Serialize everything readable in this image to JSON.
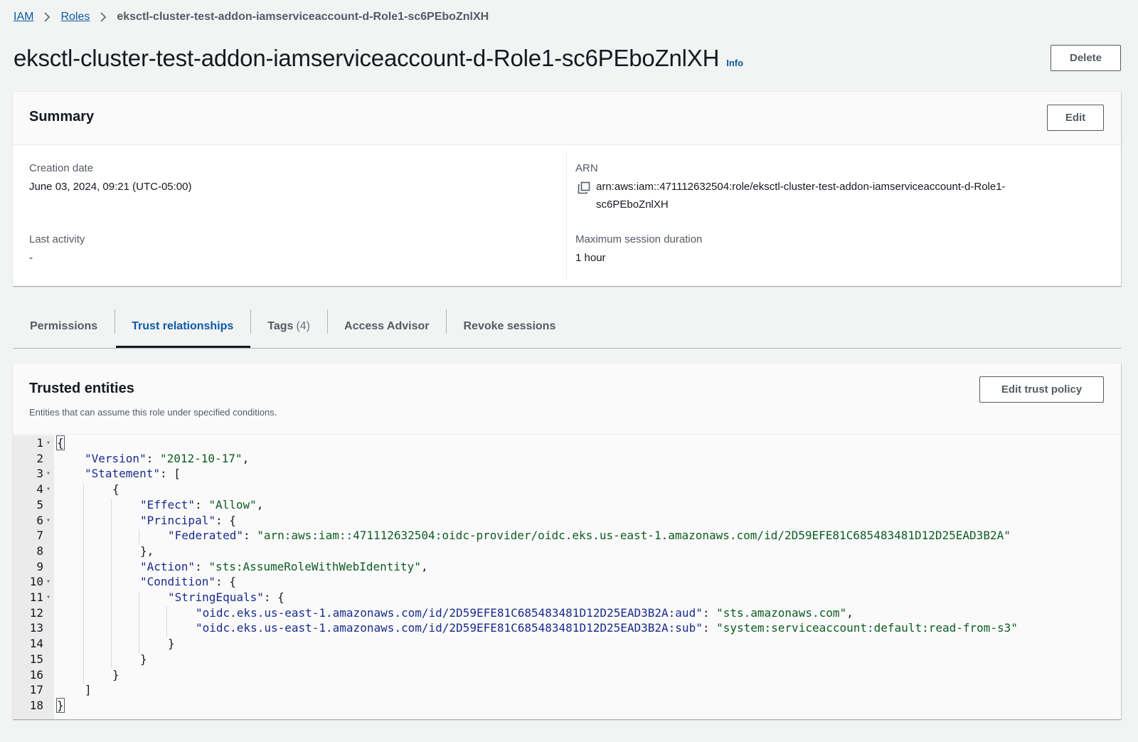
{
  "breadcrumb": {
    "items": [
      "IAM",
      "Roles"
    ],
    "current": "eksctl-cluster-test-addon-iamserviceaccount-d-Role1-sc6PEboZnlXH"
  },
  "header": {
    "title": "eksctl-cluster-test-addon-iamserviceaccount-d-Role1-sc6PEboZnlXH",
    "info": "Info",
    "delete_label": "Delete"
  },
  "summary": {
    "title": "Summary",
    "edit_label": "Edit",
    "creation_date_label": "Creation date",
    "creation_date_value": "June 03, 2024, 09:21 (UTC-05:00)",
    "last_activity_label": "Last activity",
    "last_activity_value": "-",
    "arn_label": "ARN",
    "arn_value_line1": "arn:aws:iam::471112632504:role/eksctl-cluster-test-addon-iamserviceaccount-d-Role1-",
    "arn_value_line2": "sc6PEboZnlXH",
    "max_session_label": "Maximum session duration",
    "max_session_value": "1 hour"
  },
  "tabs": [
    {
      "label": "Permissions",
      "count": ""
    },
    {
      "label": "Trust relationships",
      "count": "",
      "active": true
    },
    {
      "label": "Tags",
      "count": "(4)"
    },
    {
      "label": "Access Advisor",
      "count": ""
    },
    {
      "label": "Revoke sessions",
      "count": ""
    }
  ],
  "trust": {
    "title": "Trusted entities",
    "description": "Entities that can assume this role under specified conditions.",
    "edit_label": "Edit trust policy",
    "code_lines": [
      {
        "n": "1",
        "fold": true,
        "indent": 0,
        "parts": [
          [
            "punct",
            "{"
          ]
        ]
      },
      {
        "n": "2",
        "fold": false,
        "indent": 1,
        "parts": [
          [
            "key",
            "\"Version\""
          ],
          [
            "punct",
            ": "
          ],
          [
            "str",
            "\"2012-10-17\""
          ],
          [
            "punct",
            ","
          ]
        ]
      },
      {
        "n": "3",
        "fold": true,
        "indent": 1,
        "parts": [
          [
            "key",
            "\"Statement\""
          ],
          [
            "punct",
            ": ["
          ]
        ]
      },
      {
        "n": "4",
        "fold": true,
        "indent": 2,
        "parts": [
          [
            "punct",
            "{"
          ]
        ]
      },
      {
        "n": "5",
        "fold": false,
        "indent": 3,
        "parts": [
          [
            "key",
            "\"Effect\""
          ],
          [
            "punct",
            ": "
          ],
          [
            "str",
            "\"Allow\""
          ],
          [
            "punct",
            ","
          ]
        ]
      },
      {
        "n": "6",
        "fold": true,
        "indent": 3,
        "parts": [
          [
            "key",
            "\"Principal\""
          ],
          [
            "punct",
            ": {"
          ]
        ]
      },
      {
        "n": "7",
        "fold": false,
        "indent": 4,
        "parts": [
          [
            "key",
            "\"Federated\""
          ],
          [
            "punct",
            ": "
          ],
          [
            "str",
            "\"arn:aws:iam::471112632504:oidc-provider/oidc.eks.us-east-1.amazonaws.com/id/2D59EFE81C685483481D12D25EAD3B2A\""
          ]
        ]
      },
      {
        "n": "8",
        "fold": false,
        "indent": 3,
        "parts": [
          [
            "punct",
            "},"
          ]
        ]
      },
      {
        "n": "9",
        "fold": false,
        "indent": 3,
        "parts": [
          [
            "key",
            "\"Action\""
          ],
          [
            "punct",
            ": "
          ],
          [
            "str",
            "\"sts:AssumeRoleWithWebIdentity\""
          ],
          [
            "punct",
            ","
          ]
        ]
      },
      {
        "n": "10",
        "fold": true,
        "indent": 3,
        "parts": [
          [
            "key",
            "\"Condition\""
          ],
          [
            "punct",
            ": {"
          ]
        ]
      },
      {
        "n": "11",
        "fold": true,
        "indent": 4,
        "parts": [
          [
            "key",
            "\"StringEquals\""
          ],
          [
            "punct",
            ": {"
          ]
        ]
      },
      {
        "n": "12",
        "fold": false,
        "indent": 5,
        "parts": [
          [
            "key",
            "\"oidc.eks.us-east-1.amazonaws.com/id/2D59EFE81C685483481D12D25EAD3B2A:aud\""
          ],
          [
            "punct",
            ": "
          ],
          [
            "str",
            "\"sts.amazonaws.com\""
          ],
          [
            "punct",
            ","
          ]
        ]
      },
      {
        "n": "13",
        "fold": false,
        "indent": 5,
        "parts": [
          [
            "key",
            "\"oidc.eks.us-east-1.amazonaws.com/id/2D59EFE81C685483481D12D25EAD3B2A:sub\""
          ],
          [
            "punct",
            ": "
          ],
          [
            "str",
            "\"system:serviceaccount:default:read-from-s3\""
          ]
        ]
      },
      {
        "n": "14",
        "fold": false,
        "indent": 4,
        "parts": [
          [
            "punct",
            "}"
          ]
        ]
      },
      {
        "n": "15",
        "fold": false,
        "indent": 3,
        "parts": [
          [
            "punct",
            "}"
          ]
        ]
      },
      {
        "n": "16",
        "fold": false,
        "indent": 2,
        "parts": [
          [
            "punct",
            "}"
          ]
        ]
      },
      {
        "n": "17",
        "fold": false,
        "indent": 1,
        "parts": [
          [
            "punct",
            "]"
          ]
        ]
      },
      {
        "n": "18",
        "fold": false,
        "indent": 0,
        "parts": [
          [
            "punct",
            "}"
          ]
        ]
      }
    ]
  }
}
